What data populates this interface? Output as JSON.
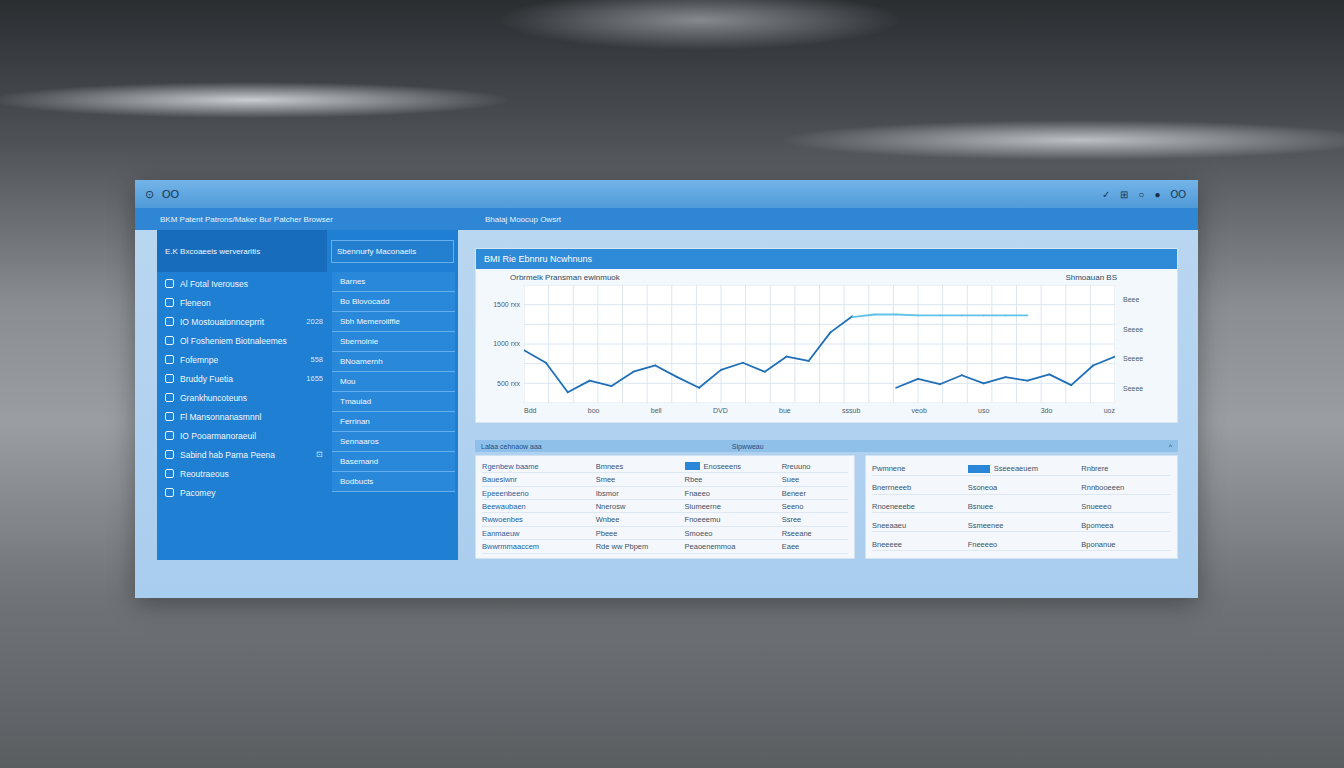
{
  "window": {
    "title_icon": "⊙",
    "title": "OO",
    "toolbar": [
      "✓",
      "⊞",
      "○",
      "●",
      "OO"
    ]
  },
  "header": {
    "breadcrumb": "BKM Patent Patrons/Maker Bur Patcher Browser",
    "tab": "Bhaiaj Moocup Owsrt"
  },
  "sidebar": {
    "title": "E.K Bxcoaeeis werveraritis",
    "subtitle": "Sbennurfy Maconaelis",
    "items": [
      {
        "label": "Al Fotal Iverouses",
        "count": ""
      },
      {
        "label": "Fleneon",
        "count": ""
      },
      {
        "label": "IO Mostouatonnceprrit",
        "count": "2028"
      },
      {
        "label": "Ol Fosheniem Biotnaleemes",
        "count": ""
      },
      {
        "label": "Fofemnpe",
        "count": "558"
      },
      {
        "label": "Bruddy Fuetia",
        "count": "1655"
      },
      {
        "label": "Grankhuncoteuns",
        "count": ""
      },
      {
        "label": "Fl Mansonnanasmnnl",
        "count": ""
      },
      {
        "label": "IO Pooarmanoraeuil",
        "count": ""
      },
      {
        "label": "Sabind hab Parna Peena",
        "count": "⊡"
      },
      {
        "label": "Reoutraeous",
        "count": ""
      },
      {
        "label": "Pacomey",
        "count": ""
      }
    ],
    "subitems": [
      "Barnes",
      "Bo Blovocadd",
      "Sbh Memeroiiffie",
      "Sbernolnie",
      "BNoamernh",
      "Mou",
      "Tmauiad",
      "Ferrinan",
      "Sennaaros",
      "Basemand",
      "Bodbucts"
    ]
  },
  "chart": {
    "header": "BMI Rie Ebnnru Ncwhnuns",
    "title": "Orbrmelk Pransman ewinmuok",
    "unit": "Shmoauan BS",
    "y_ticks": [
      "1500 rxx",
      "1000 rxx",
      "500 rxx"
    ],
    "x_ticks": [
      "Bdd",
      "boo",
      "bell",
      "DVD",
      "bue",
      "sssub",
      "veob",
      "uso",
      "3do",
      "uoz"
    ],
    "right_labels": [
      "Beee",
      "Seeee",
      "Seeee",
      "Seeee"
    ],
    "series": [
      {
        "color": "#1f6fb8",
        "start": 0,
        "values": [
          894,
          682,
          182,
          379,
          288,
          530,
          636,
          439,
          258,
          561,
          682,
          530,
          788,
          712,
          1197,
          1470
        ]
      },
      {
        "color": "#5ec3e8",
        "start": 15,
        "values": [
          1455,
          1500,
          1500,
          1485,
          1485,
          1485,
          1485,
          1485,
          1485
        ]
      },
      {
        "color": "#1f6fb8",
        "start": 17,
        "values": [
          258,
          409,
          318,
          470,
          333,
          439,
          379,
          485,
          303,
          636,
          788
        ]
      }
    ]
  },
  "strip": {
    "left": "Lalaa cehnaow aaa",
    "right": "Sipwweau",
    "caret": "^"
  },
  "left_table": {
    "rows": [
      {
        "cells": [
          "Rgenbew baame",
          "Bmnees",
          "Enoseeens",
          "Rreuuno"
        ],
        "marker": true
      },
      {
        "cells": [
          "Bauesiwnr",
          "Smee",
          "Rbee",
          "Suee"
        ],
        "marker": false
      },
      {
        "cells": [
          "Epeeenbeeno",
          "Ibsmor",
          "Fnaeeo",
          "Beneer"
        ],
        "marker": false
      },
      {
        "cells": [
          "Beewaubaen",
          "Nnerosw",
          "Siumeerne",
          "Seeno"
        ],
        "marker": false
      },
      {
        "cells": [
          "Rwwoenbes",
          "Wnbee",
          "Fnoeeemu",
          "Ssree"
        ],
        "marker": false
      },
      {
        "cells": [
          "Eanmaeuw",
          "Pbeee",
          "Smoeeo",
          "Rseeane"
        ],
        "marker": false
      },
      {
        "cells": [
          "Bwwrmmaaccem",
          "Rde ww Pbpem",
          "Peaoenemmoa",
          "Eaee"
        ],
        "marker": false
      }
    ]
  },
  "right_table": {
    "rows": [
      {
        "cells": [
          "Pwmnene",
          "Sseeeaeuem",
          "Rnbrere"
        ],
        "marker": true
      },
      {
        "cells": [
          "Bnerrneeeb",
          "Ssoneoa",
          "Rnnbooeeen"
        ],
        "marker": false
      },
      {
        "cells": [
          "Rnoeneeebe",
          "Bsnuee",
          "Snueeeo"
        ],
        "marker": false
      },
      {
        "cells": [
          "Sneeaaeu",
          "Ssmeenee",
          "Bpomeea"
        ],
        "marker": false
      },
      {
        "cells": [
          "Bneeeee",
          "Fneeeeo",
          "Bponanue"
        ],
        "marker": false
      }
    ]
  }
}
